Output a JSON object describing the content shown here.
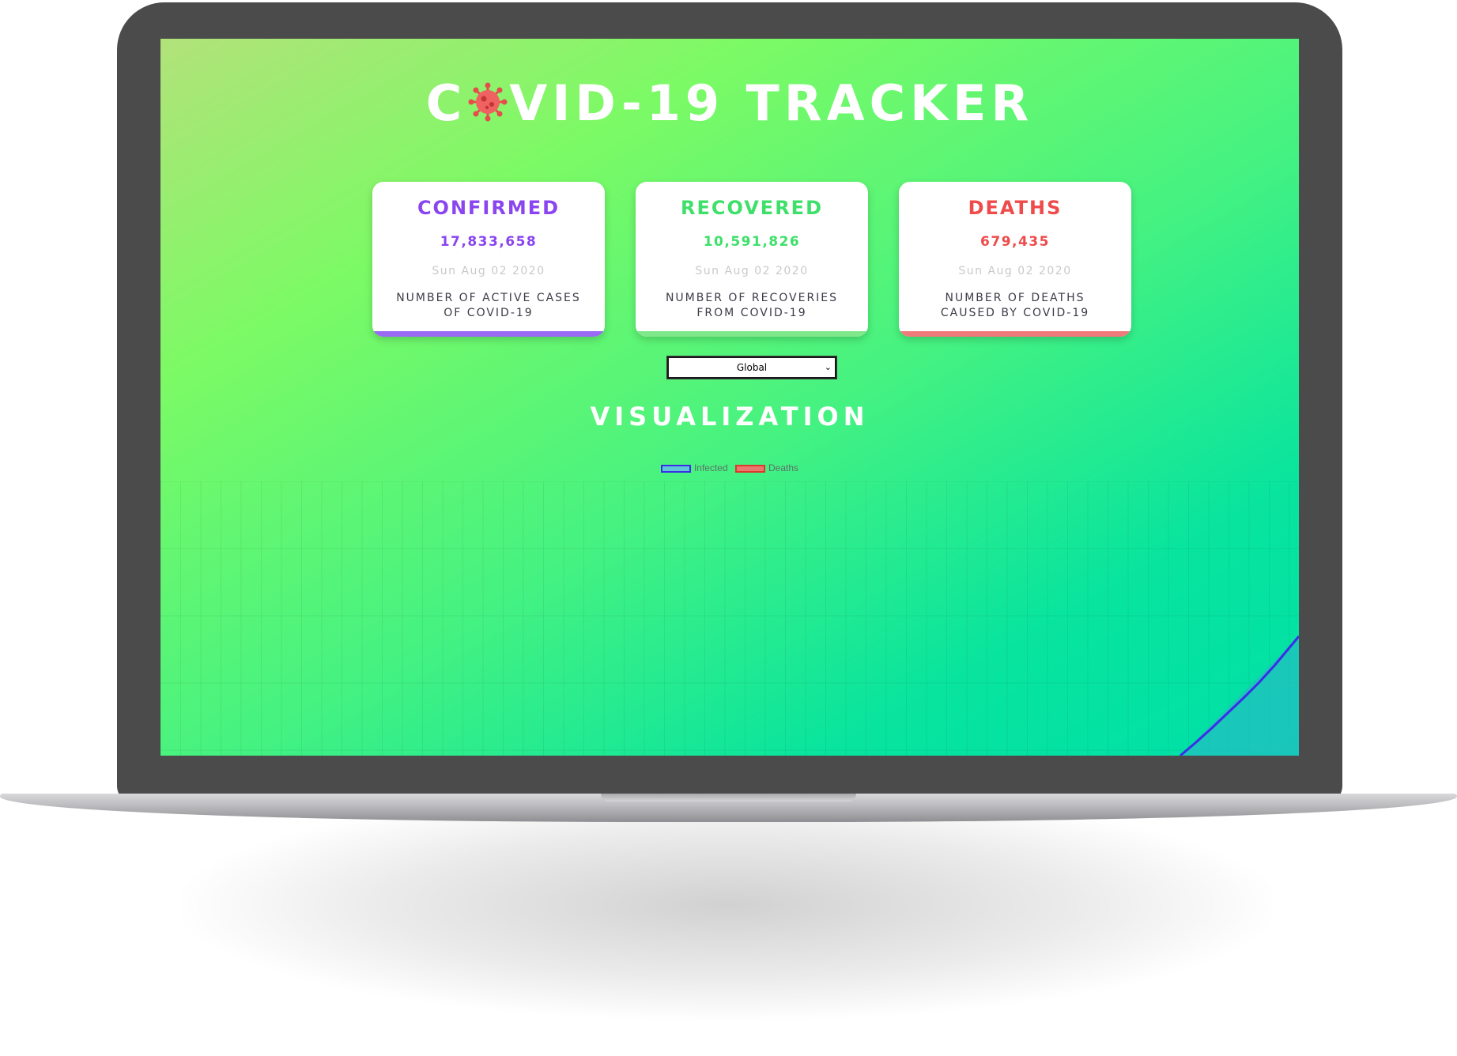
{
  "app": {
    "title_before": "C",
    "title_after": "VID-19 TRACKER",
    "title_icon": "virus-icon"
  },
  "cards": [
    {
      "heading": "CONFIRMED",
      "value": "17,833,658",
      "date": "Sun Aug 02 2020",
      "desc_line1": "NUMBER OF ACTIVE CASES",
      "desc_line2": "OF COVID-19",
      "color": "#8a45f0"
    },
    {
      "heading": "RECOVERED",
      "value": "10,591,826",
      "date": "Sun Aug 02 2020",
      "desc_line1": "NUMBER OF RECOVERIES",
      "desc_line2": "FROM COVID-19",
      "color": "#3ee06a"
    },
    {
      "heading": "DEATHS",
      "value": "679,435",
      "date": "Sun Aug 02 2020",
      "desc_line1": "NUMBER OF DEATHS",
      "desc_line2": "CAUSED BY COVID-19",
      "color": "#ef4b4b"
    }
  ],
  "country_select": {
    "selected": "Global"
  },
  "visualization": {
    "heading": "VISUALIZATION"
  },
  "legend": [
    {
      "label": "Infected",
      "color": "#3a2ee8"
    },
    {
      "label": "Deaths",
      "color": "#e0362c"
    }
  ],
  "colors": {
    "infected_fill": "#22bfc0",
    "deaths_fill": "#e0362c"
  }
}
